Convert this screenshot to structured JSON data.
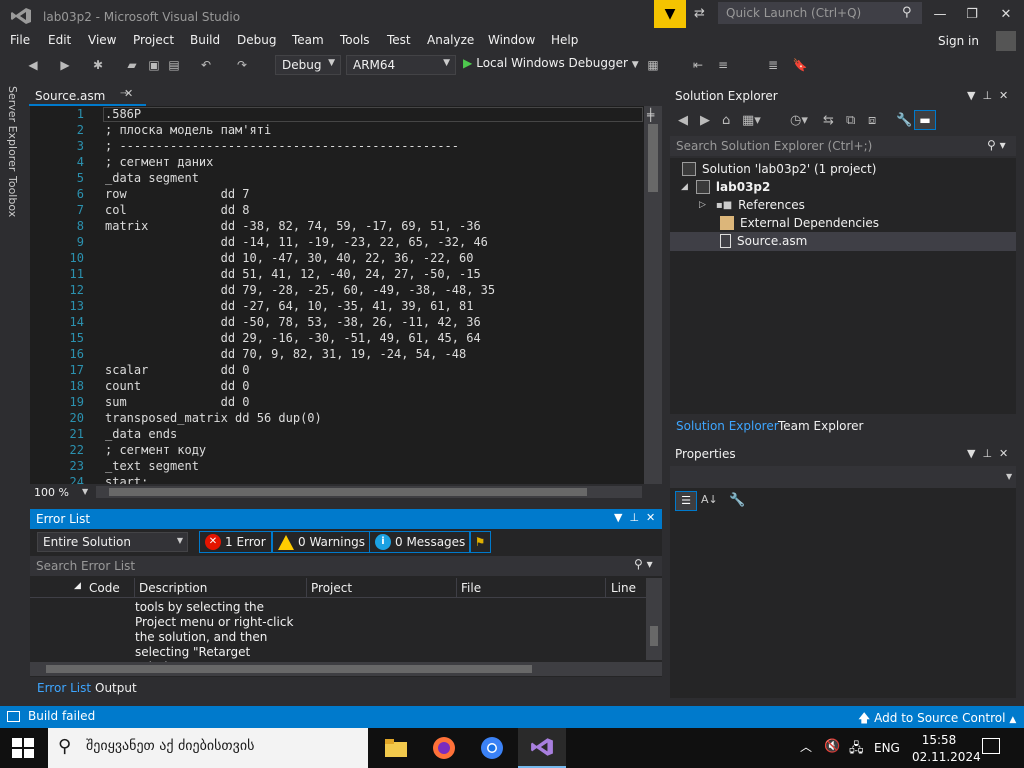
{
  "window": {
    "title": "lab03p2 - Microsoft Visual Studio",
    "quick_launch_placeholder": "Quick Launch (Ctrl+Q)",
    "sign_in": "Sign in"
  },
  "menu": [
    "File",
    "Edit",
    "View",
    "Project",
    "Build",
    "Debug",
    "Team",
    "Tools",
    "Test",
    "Analyze",
    "Window",
    "Help"
  ],
  "toolbar": {
    "configuration": "Debug",
    "platform": "ARM64",
    "run_label": "Local Windows Debugger"
  },
  "side_tabs": [
    "Server Explorer",
    "Toolbox"
  ],
  "editor": {
    "tab_name": "Source.asm",
    "zoom": "100 %",
    "line_numbers": [
      "1",
      "2",
      "3",
      "4",
      "5",
      "6",
      "7",
      "8",
      "9",
      "10",
      "11",
      "12",
      "13",
      "14",
      "15",
      "16",
      "17",
      "18",
      "19",
      "20",
      "21",
      "22",
      "23",
      "24"
    ],
    "lines": [
      ".586P",
      "; плоска модель пам'яті",
      "; -----------------------------------------------",
      "; сегмент даних",
      "_data segment",
      "row             dd 7",
      "col             dd 8",
      "matrix          dd -38, 82, 74, 59, -17, 69, 51, -36",
      "                dd -14, 11, -19, -23, 22, 65, -32, 46",
      "                dd 10, -47, 30, 40, 22, 36, -22, 60",
      "                dd 51, 41, 12, -40, 24, 27, -50, -15",
      "                dd 79, -28, -25, 60, -49, -38, -48, 35",
      "                dd -27, 64, 10, -35, 41, 39, 61, 81",
      "                dd -50, 78, 53, -38, 26, -11, 42, 36",
      "                dd 29, -16, -30, -51, 49, 61, 45, 64",
      "                dd 70, 9, 82, 31, 19, -24, 54, -48",
      "scalar          dd 0",
      "count           dd 0",
      "sum             dd 0",
      "transposed_matrix dd 56 dup(0)",
      "_data ends",
      "; сегмент коду",
      "_text segment",
      "start:"
    ]
  },
  "error_list": {
    "title": "Error List",
    "scope": "Entire Solution",
    "errors": "1 Error",
    "warnings": "0 Warnings",
    "messages": "0 Messages",
    "search_placeholder": "Search Error List",
    "columns": [
      "Code",
      "Description",
      "Project",
      "File",
      "Line"
    ],
    "description_text": "tools by selecting the Project menu or right-click the solution, and then selecting \"Retarget solution\".",
    "tabs": [
      "Error List",
      "Output"
    ]
  },
  "solution_explorer": {
    "title": "Solution Explorer",
    "search_placeholder": "Search Solution Explorer (Ctrl+;)",
    "tree": [
      "Solution 'lab03p2' (1 project)",
      "lab03p2",
      "References",
      "External Dependencies",
      "Source.asm"
    ],
    "tabs": [
      "Solution Explorer",
      "Team Explorer"
    ]
  },
  "properties": {
    "title": "Properties"
  },
  "status_bar": {
    "build_status": "Build failed",
    "source_control": "Add to Source Control"
  },
  "taskbar": {
    "search_placeholder": "შეიყვანეთ აქ ძიებისთვის",
    "language": "ENG",
    "time": "15:58",
    "date": "02.11.2024"
  },
  "colors": {
    "accent": "#007acc",
    "background": "#2d2d30",
    "editor_bg": "#1e1e1e",
    "line_number": "#2b91af",
    "error": "#e51400",
    "warning": "#ffcc00",
    "run": "#4ec94e"
  }
}
